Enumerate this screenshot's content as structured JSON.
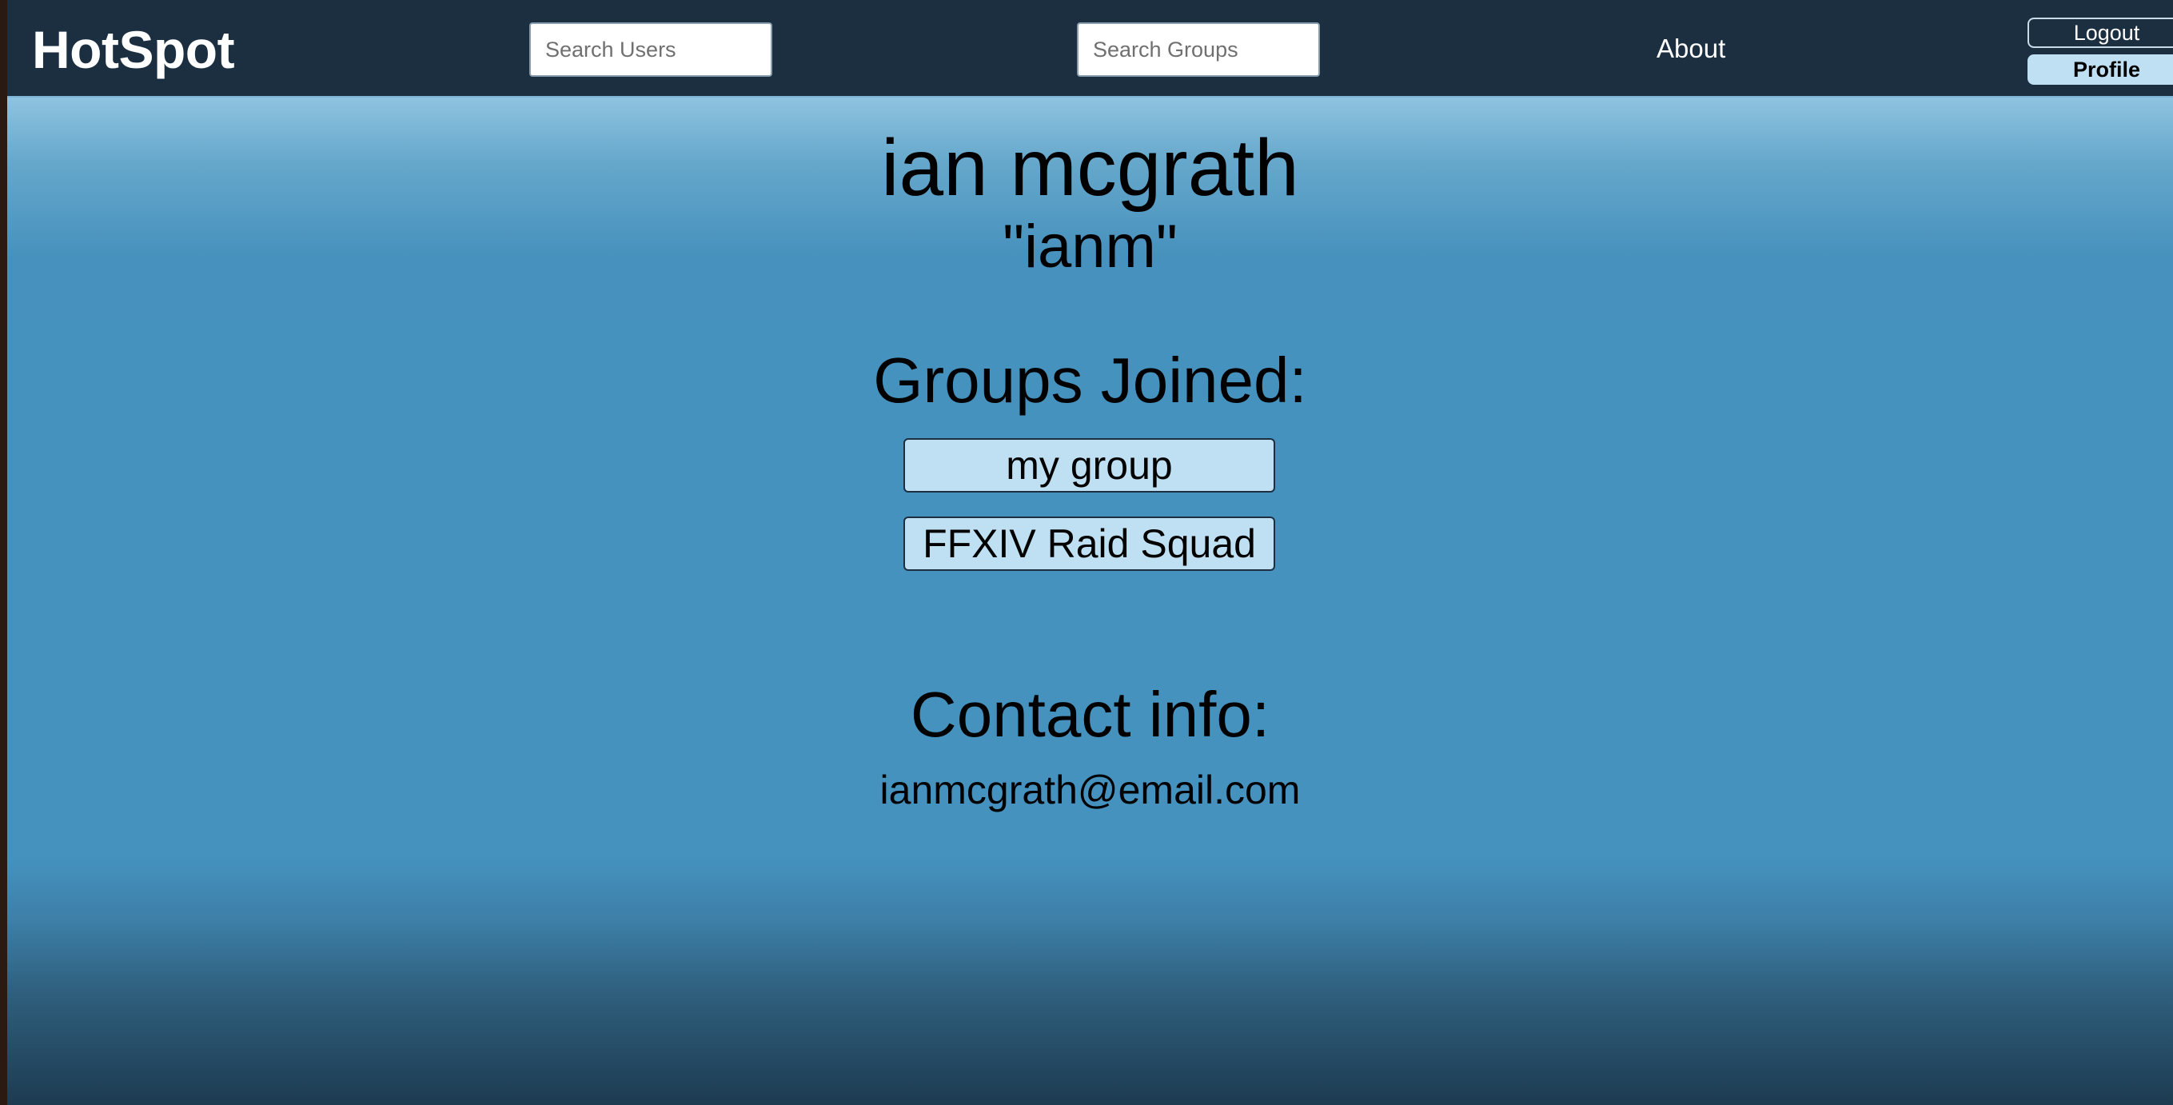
{
  "header": {
    "brand": "HotSpot",
    "search_users_placeholder": "Search Users",
    "search_groups_placeholder": "Search Groups",
    "about_label": "About",
    "logout_label": "Logout",
    "profile_label": "Profile"
  },
  "profile": {
    "full_name": "ian mcgrath",
    "username": "\"ianm\"",
    "groups_heading": "Groups Joined:",
    "groups": [
      {
        "label": "my group"
      },
      {
        "label": "FFXIV Raid Squad"
      }
    ],
    "contact_heading": "Contact info:",
    "email": "ianmcgrath@email.com"
  },
  "colors": {
    "navbar": "#1b2f41",
    "accent_button": "#bfe0f2",
    "background_main": "#4592bf"
  }
}
